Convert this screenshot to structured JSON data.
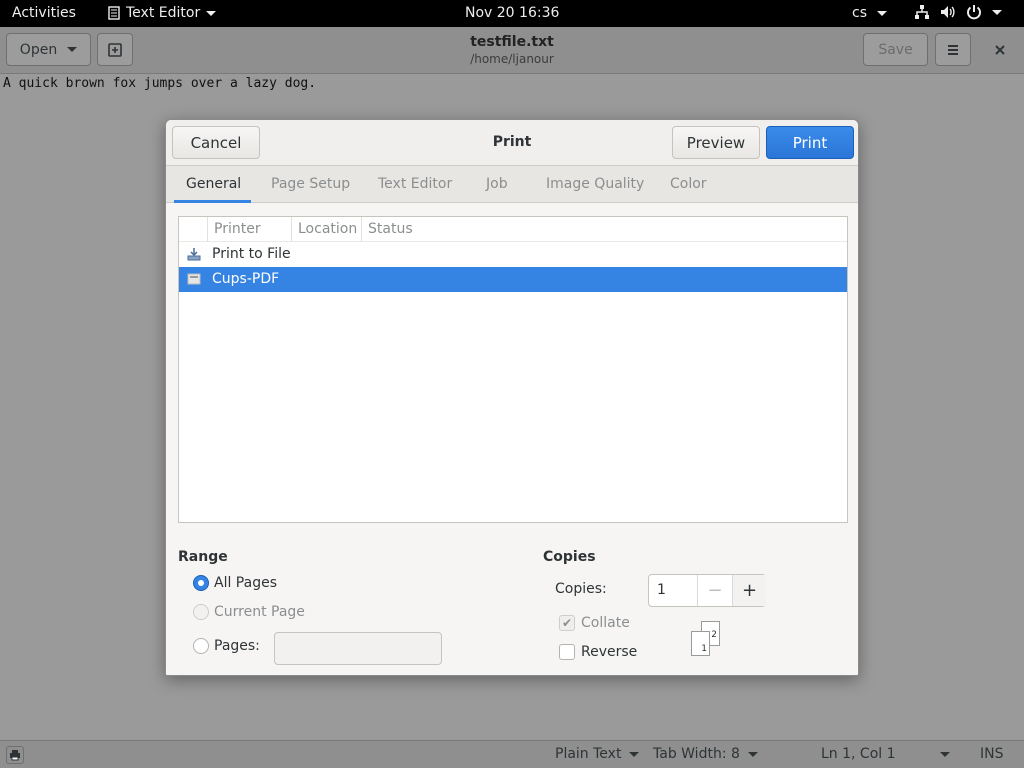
{
  "topbar": {
    "activities": "Activities",
    "app_name": "Text Editor",
    "clock": "Nov 20  16:36",
    "language": "cs"
  },
  "headerbar": {
    "open_label": "Open",
    "title": "testfile.txt",
    "subtitle": "/home/ljanour",
    "save_label": "Save"
  },
  "editor": {
    "content": "A quick brown fox jumps over a lazy dog."
  },
  "statusbar": {
    "language": "Plain Text",
    "tab_width": "Tab Width: 8",
    "position": "Ln 1, Col 1",
    "mode": "INS"
  },
  "dialog": {
    "title": "Print",
    "cancel_label": "Cancel",
    "preview_label": "Preview",
    "print_label": "Print",
    "tabs": [
      {
        "label": "General"
      },
      {
        "label": "Page Setup"
      },
      {
        "label": "Text Editor"
      },
      {
        "label": "Job"
      },
      {
        "label": "Image Quality"
      },
      {
        "label": "Color"
      }
    ],
    "printer_list": {
      "columns": [
        "Printer",
        "Location",
        "Status"
      ],
      "rows": [
        {
          "name": "Print to File",
          "icon": "save-to-file-icon",
          "selected": false
        },
        {
          "name": "Cups-PDF",
          "icon": "printer-icon",
          "selected": true
        }
      ]
    },
    "range": {
      "title": "Range",
      "all_pages": "All Pages",
      "current_page": "Current Page",
      "pages": "Pages:"
    },
    "copies": {
      "title": "Copies",
      "copies_label": "Copies:",
      "copies_value": "1",
      "collate": "Collate",
      "reverse": "Reverse"
    }
  },
  "colors": {
    "accent": "#3584e4",
    "window_bg": "#f6f5f4",
    "topbar_bg": "#000000"
  }
}
